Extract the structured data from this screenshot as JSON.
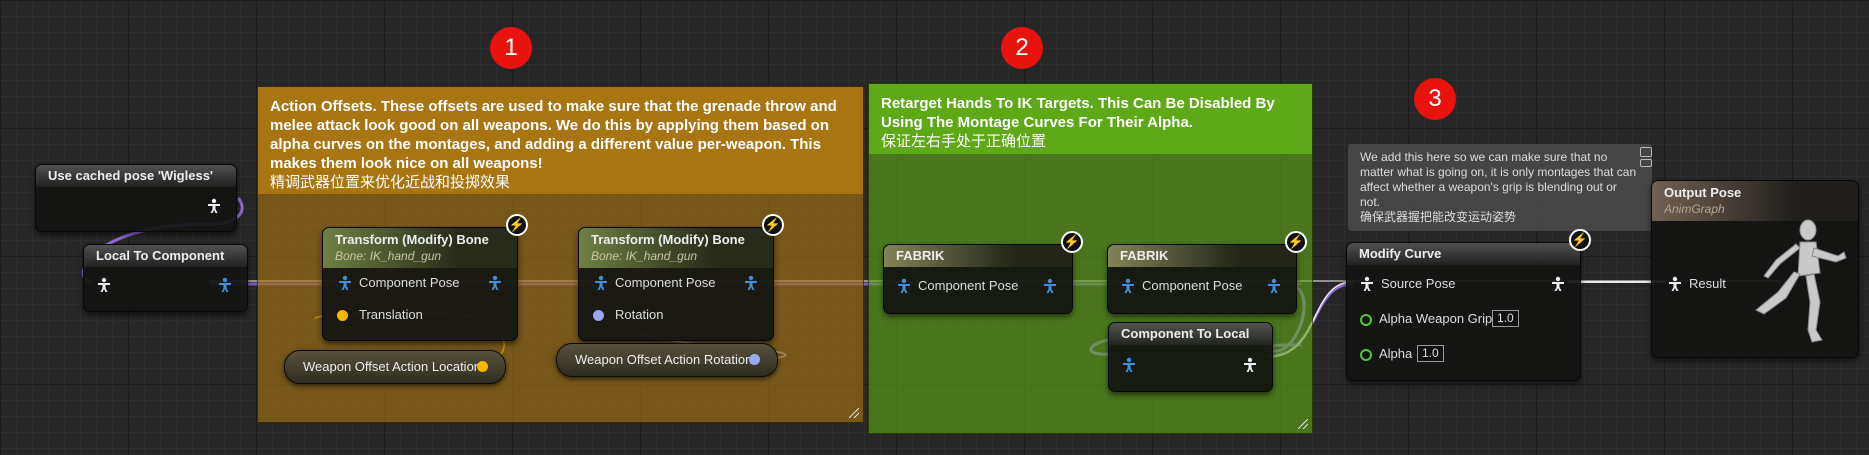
{
  "badges": [
    "1",
    "2",
    "3"
  ],
  "comments": {
    "action_offsets": {
      "text": "Action Offsets. These offsets are used to make sure that the grenade throw and melee attack look good on all weapons. We do this by applying them based on alpha curves on the montages, and adding a different value per-weapon. This makes them look nice on all weapons!",
      "text_cn": "精调武器位置来优化近战和投掷效果",
      "color": "#a87512"
    },
    "retarget": {
      "text": "Retarget Hands To IK Targets. This Can Be Disabled By Using The Montage Curves For Their Alpha.",
      "text_cn": "保证左右手处于正确位置",
      "color": "#5fa817"
    }
  },
  "nodes": {
    "cached_pose": {
      "title": "Use cached pose 'Wigless'"
    },
    "local_to_component": {
      "title": "Local To Component"
    },
    "transform_1": {
      "title": "Transform (Modify) Bone",
      "subtitle": "Bone: IK_hand_gun",
      "pin_pose": "Component Pose",
      "pin_in": "Translation"
    },
    "transform_2": {
      "title": "Transform (Modify) Bone",
      "subtitle": "Bone: IK_hand_gun",
      "pin_pose": "Component Pose",
      "pin_in": "Rotation"
    },
    "offset_location": {
      "label": "Weapon Offset Action Location"
    },
    "offset_rotation": {
      "label": "Weapon Offset Action Rotation"
    },
    "fabrik_1": {
      "title": "FABRIK",
      "pin_pose": "Component Pose"
    },
    "fabrik_2": {
      "title": "FABRIK",
      "pin_pose": "Component Pose"
    },
    "component_to_local": {
      "title": "Component To Local"
    },
    "modify_curve": {
      "title": "Modify Curve",
      "pin_source": "Source Pose",
      "pin_grip": "Alpha Weapon Grip",
      "pin_grip_value": "1.0",
      "pin_alpha": "Alpha",
      "pin_alpha_value": "1.0"
    },
    "output_pose": {
      "title": "Output Pose",
      "subtitle": "AnimGraph",
      "pin_result": "Result"
    }
  },
  "tooltip": {
    "text": "We add this here so we can make sure that no matter what is going on, it is only montages that can affect whether a weapon's grip is blending out or not.",
    "text_cn": "确保武器握把能改变运动姿势"
  },
  "colors": {
    "pose_pin": "#3f8fe0",
    "translation_pin": "#f5b800",
    "rotation_pin": "#9aa8f0",
    "float_pin": "#4fc93b",
    "wire_white": "#e8e8e8",
    "wire_purple": "#8f6bd8"
  }
}
